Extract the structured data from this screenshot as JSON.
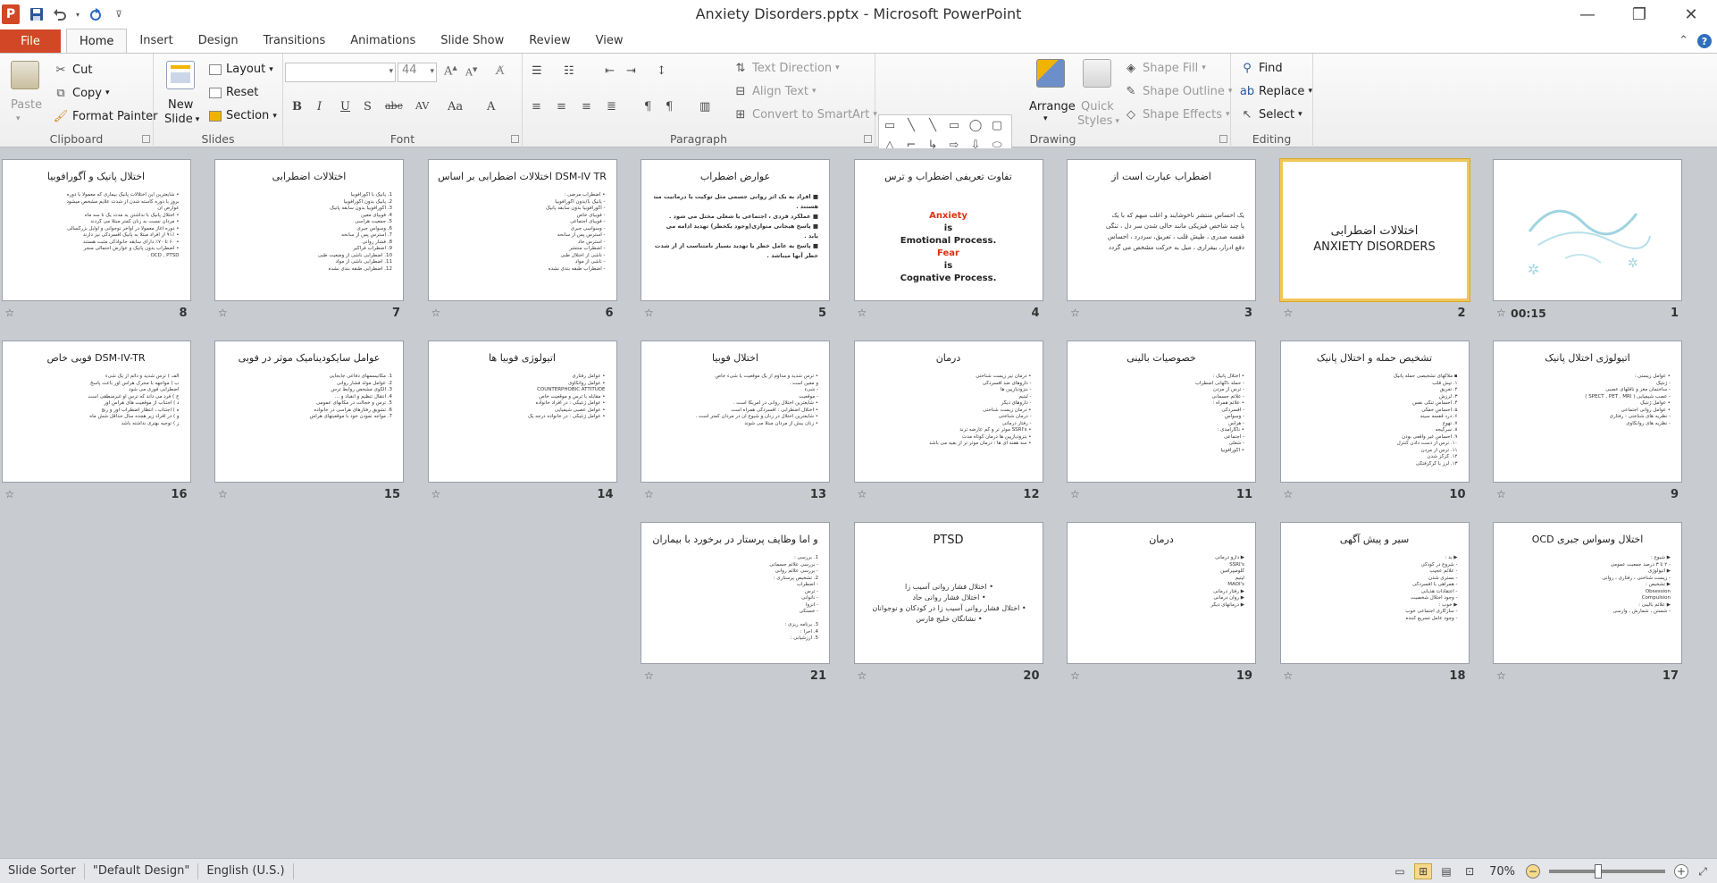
{
  "window": {
    "title": "Anxiety Disorders.pptx - Microsoft PowerPoint",
    "app_logo": "P"
  },
  "qat": {
    "icons": [
      "save-icon",
      "undo-icon",
      "redo-icon",
      "customize-icon"
    ]
  },
  "tabs": {
    "file": "File",
    "items": [
      "Home",
      "Insert",
      "Design",
      "Transitions",
      "Animations",
      "Slide Show",
      "Review",
      "View"
    ],
    "active": "Home"
  },
  "ribbon": {
    "clipboard": {
      "label": "Clipboard",
      "paste": "Paste",
      "cut": "Cut",
      "copy": "Copy",
      "format_painter": "Format Painter"
    },
    "slides": {
      "label": "Slides",
      "new_slide_1": "New",
      "new_slide_2": "Slide",
      "layout": "Layout",
      "reset": "Reset",
      "section": "Section"
    },
    "font": {
      "label": "Font",
      "font_name": "",
      "font_size": "44"
    },
    "paragraph": {
      "label": "Paragraph",
      "text_direction": "Text Direction",
      "align_text": "Align Text",
      "convert_smartart": "Convert to SmartArt"
    },
    "drawing": {
      "label": "Drawing",
      "arrange": "Arrange",
      "quick_styles_1": "Quick",
      "quick_styles_2": "Styles",
      "shape_fill": "Shape Fill",
      "shape_outline": "Shape Outline",
      "shape_effects": "Shape Effects"
    },
    "editing": {
      "label": "Editing",
      "find": "Find",
      "replace": "Replace",
      "select": "Select"
    }
  },
  "slides": [
    {
      "num": "1",
      "title": "",
      "body": [],
      "time": "00:15",
      "type": "calligraphy"
    },
    {
      "num": "2",
      "title": "اختلالات اضطرابی",
      "subtitle": "ANXIETY DISORDERS",
      "body": [],
      "selected": true,
      "type": "title"
    },
    {
      "num": "3",
      "title": "اضطراب عبارت است از",
      "body": [
        "یک احساس منتشر ناخوشایند و اغلب مبهم که با یک",
        "یا چند شاخص فیزیکی مانند خالی شدن سر دل ، تنگی",
        "قفسه صدری ، طپش قلب ، تعریق، سردرد ، احساس",
        "دفع ادرار، بیقراری ، میل به حرکت مشخص می گردد"
      ]
    },
    {
      "num": "4",
      "title": "تفاوت تعریفی اضطراب و ترس",
      "type": "center",
      "center_lines": [
        {
          "t": "Anxiety",
          "c": "#e03010"
        },
        {
          "t": "is",
          "c": "#222"
        },
        {
          "t": "Emotional Process.",
          "c": "#222"
        },
        {
          "t": "Fear",
          "c": "#e03010"
        },
        {
          "t": "is",
          "c": "#222"
        },
        {
          "t": "Cognative Process.",
          "c": "#222"
        }
      ],
      "body": []
    },
    {
      "num": "5",
      "title": "عوارض اضطراب",
      "body": [
        "■ افراد به یک اثر روانی جسمی مثل توکیت یا درماتیت مبتلا",
        "  هستند .",
        "■ عملکرد فردی ، اجتماعی یا شغلی مختل می شود .",
        "■ پاسخ هیجانی متوازی(وجود یکخطر) تهدید ادامه می",
        "  یابد .",
        "■ پاسخ به عامل خطر یا تهدید بسیار نامتناسب از از شدت و",
        "  خطر آنها میباشد ."
      ]
    },
    {
      "num": "6",
      "title": "DSM-IV TR اختلالات اضطرابی بر اساس",
      "body": [
        "• اضطراب مرضی :",
        "  - پانیک با/بدون آگورافوبیا",
        "  - آگورافوبیا بدون سابقه پانیک",
        "  - فوبیای خاص",
        "  - فوبیای اجتماعی",
        "  - وسواسی جبری",
        "  - استرس پس از سانحه",
        "  - استرس حاد",
        "  - اضطراب منتشر",
        "  - ناشی از اختلال طبی",
        "  - ناشی از مواد",
        "  - اضطراب طبقه بندی نشده"
      ]
    },
    {
      "num": "7",
      "title": "اختلالات اضطرابی",
      "body": [
        "1. پانیک با آگورافوبیا",
        "2. پانیک بدون آگورافوبیا",
        "3. آگورافوبیا بدون سابقه پانیک",
        "4. فوبیای معین",
        "5. جمعیت هراسی",
        "6. وسواس جبری",
        "7. استرس پس از سانحه",
        "8. فشار روانی",
        "9. اضطراب فراگیر",
        "10. اضطرابی ناشی از وضعیت طبی",
        "11. اضطرابی ناشی از مواد",
        "12. اضطرابی طبقه بندی نشده"
      ]
    },
    {
      "num": "8",
      "title": "اختلال پانیک و آگورافوبیا",
      "body": [
        "• شایعترین این اختلالات پانیک بیماری که معمولا با دوره",
        "  بروز با دوره کاسته شدن از شدت علایم مشخص میشود",
        "  عوارض آن",
        "• اختلال پانیک با نداشتن به مدت یک تا سه ماه",
        "• مردان نسبت به زنان کمتر مبتلا می گردند",
        "• دوره آغاز معمولا در اواخر نوجوانی و اوایل بزرگسالی",
        "• ۹۱٪ از افراد مبتلا به پانیک افسردگی نیز دارند",
        "• ۶۰ تا ۷۰٪ دارای سابقه خانوادگی مثبت هستند",
        "• اضطراب بدون پانیک و عوارض احتمالی منجر",
        "  OCD , PTSD ."
      ]
    },
    {
      "num": "9",
      "title": "اتیولوژی اختلال پانیک",
      "body": [
        "• عوامل زیستی :",
        "  - ژنتیک",
        "  - ساختمان مغز و ناقلهای عصبی",
        "  - عصب شیمیایی ( SPECT , PET , MRI )",
        "• عوامل ژنتیک",
        "• عوامل روانی اجتماعی",
        "  - نظریه های شناختی - رفتاری",
        "  - نظریه های روانکاوی"
      ]
    },
    {
      "num": "10",
      "title": "تشخیص حمله و اختلال پانیک",
      "body": [
        "▪ ملاکهای تشخیصی حمله پانیک",
        "  ۱. تپش قلب",
        "  ۲. تعریق",
        "  ۳. لرزش",
        "  ۴. احساس تنگی نفس",
        "  ۵. احساس خفگی",
        "  ۶. درد قفسه سینه",
        "  ۷. تهوع",
        "  ۸. سرگیجه",
        "  ۹. احساس غیر واقعی بودن",
        "  ۱۰. ترس از دست دادن کنترل",
        "  ۱۱. ترس از مردن",
        "  ۱۲. گزگز شدن",
        "  ۱۳. لرز یا گرگرفتگی"
      ]
    },
    {
      "num": "11",
      "title": "خصوصیات بالینی",
      "body": [
        "• اختلال پانیک :",
        "  - حمله ناگهانی اضطراب",
        "  - ترس از مردن",
        "  - علائم جسمانی",
        "• علائم همراه :",
        "  - افسردگی",
        "  - وسواس",
        "  - هراس",
        "• ناکارآمدی :",
        "  - اجتماعی",
        "  - شغلی",
        "• آگورافوبیا"
      ]
    },
    {
      "num": "12",
      "title": "درمان",
      "body": [
        "• درمان تیر زیست شناختی",
        "  - داروهای ضد افسردگی",
        "  - بنزودیازپین ها",
        "  - لیتیم",
        "  - داروهای دیگر",
        "• درمان زیست شناختی",
        "  - درمان شناختی",
        "  - رفتار درمانی",
        "• SSRI's موثر تر و کم عارضه ترند",
        "• بنزودیازپین ها درمان کوتاه مدت",
        "• سه هفته ای ها : درمان موثر تر از بقیه می باشد"
      ]
    },
    {
      "num": "13",
      "title": "اختلال فوبیا",
      "body": [
        "• ترس شدید و مداوم از یک موقعیت یا شیء خاص",
        "  و معین است .",
        "  - شیء",
        "  - موقعیت",
        "• شایعترین اختلال روانی در آمریکا است .",
        "• اختلال اضطرابی : افسردگی همراه است",
        "• شایعترین اختلال در زنان و شیوع آن در مردان کمتر است .",
        "• زنان بیش از مردان مبتلا می شوند"
      ]
    },
    {
      "num": "14",
      "title": "اتیولوژی فوبیا ها",
      "body": [
        "• عوامل رفتاری",
        "• عوامل روانکاوی",
        "COUNTERPHOBIC ATTITUDE",
        "• مقابله با ترس و موقعیت خاص",
        "• عوامل ژنتیکی : در افراد خانواده",
        "• عوامل عصبی شیمیایی",
        "• عوامل ژنتیکی : در خانواده درجه یک"
      ]
    },
    {
      "num": "15",
      "title": "عوامل سایکودینامیک موثر در فوبی",
      "body": [
        "1. مکانیسمهای دفاعی جابجایی",
        "2. عوامل مولد فشار روانی",
        "3. الگوی مشخص روابط ترس",
        "4. انتقال تنظیم و انقباد و ...",
        "5. ترس و خجالت در مکانهای عمومی",
        "6. تشویق رفتارهای هراسی در خانواده",
        "7. مواجه نمودن خود با موقعیتهای هراس"
      ]
    },
    {
      "num": "16",
      "title": "DSM-IV-TR فوبی خاص",
      "body": [
        "الف ) ترس شدید و دائم از یک شیء",
        "ب ) مواجهه با محرک هراس آور باعث پاسخ",
        "   اضطرابی فوری می شود",
        "ج ) فرد می داند که ترس او غیرمنطقی است",
        "د ) اجتناب از موقعیت های هراس آور",
        "ه ) اجتناب ، انتظار اضطراب آور و رنج",
        "و ) در افراد زیر هجده سال حداقل شش ماه",
        "ز ) توجیه بهتری نداشته باشد"
      ]
    },
    {
      "num": "17",
      "title": "اختلال وسواس جبری OCD",
      "body": [
        "▶ شیوع :",
        "  - ۲ تا ۳ درصد جمعیت عمومی",
        "▶ اتیولوژی",
        "  - زیست شناختی ، رفتاری ، روانی",
        "▶ تشخیص :",
        "  Obsession",
        "  Compulsion",
        "▶ علائم بالینی :",
        "  - شستن ، شمارش ، وارسی"
      ]
    },
    {
      "num": "18",
      "title": "سیر و پیش آگهی",
      "body": [
        "▶ بد :",
        "  - شروع در کودکی",
        "  - علائم عجیب",
        "  - بستری شدن",
        "  - همراهی با افسردگی",
        "  - اعتقادات هذیانی",
        "  - وجود اختلال شخصیت",
        "▶ خوب :",
        "  - سازگاری اجتماعی خوب",
        "  - وجود عامل تسریع کننده"
      ]
    },
    {
      "num": "19",
      "title": "درمان",
      "body": [
        "▶ دارو درمانی",
        "  SSRI's",
        "  کلومیپرامین",
        "  لیتیم",
        "  MAOI's",
        "▶ رفتار درمانی",
        "▶ روان درمانی",
        "▶ درمانهای دیگر"
      ]
    },
    {
      "num": "20",
      "title": "PTSD",
      "type": "ptsd",
      "body": [
        "• اختلال فشار روانی آسیب زا",
        "• اختلال فشار روانی حاد",
        "• اختلال فشار روانی آسیب زا در کودکان و نوجوانان",
        "• نشانگان خلیج فارس"
      ]
    },
    {
      "num": "21",
      "title": "و اما وظایف پرستار در برخورد با بیماران",
      "body": [
        "1. بررسی :",
        "  - بررسی علائم جسمانی",
        "  - بررسی علائم روانی",
        "2. تشخیص پرستاری :",
        "  - اضطراب",
        "  - ترس",
        "  - ناتوانی",
        "  - انزوا",
        "  - خستگی",
        "",
        "3. برنامه ریزی :",
        "4. اجرا :",
        "5. ارزشیابی :"
      ]
    }
  ],
  "status": {
    "view": "Slide Sorter",
    "theme": "\"Default Design\"",
    "language": "English (U.S.)",
    "zoom": "70%",
    "zoom_fraction": 0.42
  }
}
